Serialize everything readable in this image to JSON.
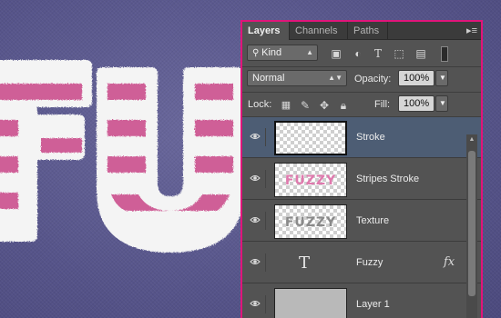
{
  "canvas": {
    "text": "FUZZY",
    "colors": {
      "background": "#5c5a8e",
      "stripe_pink": "#cf5f97",
      "stripe_white": "#f2f2f2"
    }
  },
  "panel": {
    "tabs": [
      {
        "label": "Layers",
        "active": true
      },
      {
        "label": "Channels",
        "active": false
      },
      {
        "label": "Paths",
        "active": false
      }
    ],
    "menu_icon": "panel-menu-icon",
    "filter": {
      "kind_label": "Kind",
      "icons": [
        "image-filter-icon",
        "adjustment-filter-icon",
        "type-filter-icon",
        "shape-filter-icon",
        "smart-object-filter-icon",
        "filter-toggle-icon"
      ]
    },
    "blend_mode": "Normal",
    "opacity": {
      "label": "Opacity:",
      "value": "100%"
    },
    "lock": {
      "label": "Lock:",
      "icons": [
        "lock-transparent-icon",
        "lock-image-icon",
        "lock-position-icon",
        "lock-all-icon"
      ]
    },
    "fill": {
      "label": "Fill:",
      "value": "100%"
    },
    "layers": [
      {
        "name": "Stroke",
        "selected": true,
        "thumb": "checker"
      },
      {
        "name": "Stripes Stroke",
        "selected": false,
        "thumb": "checker",
        "thumb_text": "FUZZY"
      },
      {
        "name": "Texture",
        "selected": false,
        "thumb": "checker",
        "thumb_text": "FUZZY"
      },
      {
        "name": "Fuzzy",
        "selected": false,
        "thumb": "type",
        "type_glyph": "T",
        "fx_label": "fx"
      },
      {
        "name": "Layer 1",
        "selected": false,
        "thumb": "gray"
      }
    ]
  }
}
